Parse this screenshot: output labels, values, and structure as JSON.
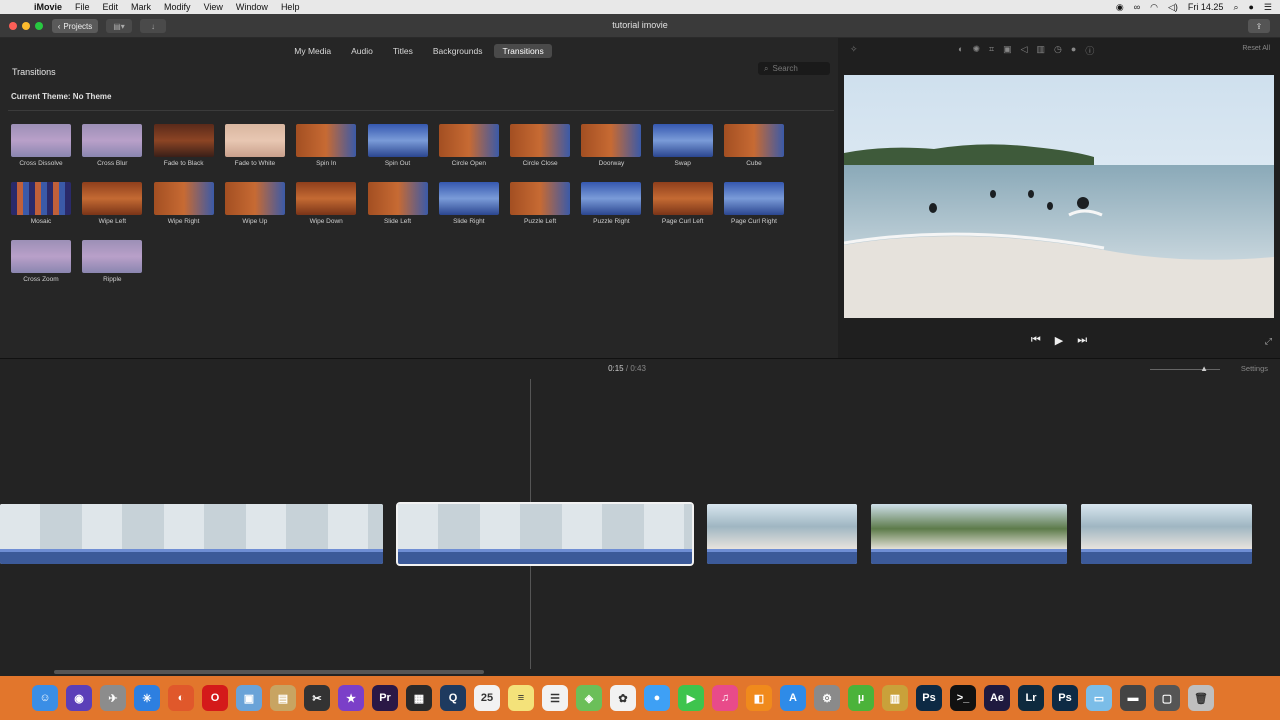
{
  "menubar": {
    "app": "iMovie",
    "items": [
      "File",
      "Edit",
      "Mark",
      "Modify",
      "View",
      "Window",
      "Help"
    ],
    "clock": "Fri 14.25"
  },
  "window": {
    "title": "tutorial imovie",
    "projects_label": "Projects"
  },
  "browser": {
    "tabs": [
      {
        "label": "My Media",
        "active": false
      },
      {
        "label": "Audio",
        "active": false
      },
      {
        "label": "Titles",
        "active": false
      },
      {
        "label": "Backgrounds",
        "active": false
      },
      {
        "label": "Transitions",
        "active": true
      }
    ],
    "section_title": "Transitions",
    "search_placeholder": "Search",
    "current_theme": "Current Theme: No Theme",
    "transitions": [
      {
        "label": "Cross Dissolve",
        "style": "purple"
      },
      {
        "label": "Cross Blur",
        "style": "purple"
      },
      {
        "label": "Fade to Black",
        "style": "dark"
      },
      {
        "label": "Fade to White",
        "style": "light"
      },
      {
        "label": "Spin In",
        "style": "mix"
      },
      {
        "label": "Spin Out",
        "style": "blue"
      },
      {
        "label": "Circle Open",
        "style": "mix"
      },
      {
        "label": "Circle Close",
        "style": "mix"
      },
      {
        "label": "Doorway",
        "style": "mix"
      },
      {
        "label": "Swap",
        "style": "blue"
      },
      {
        "label": "Cube",
        "style": "mix"
      },
      {
        "label": "Mosaic",
        "style": "mosaic"
      },
      {
        "label": "Wipe Left",
        "style": "forest"
      },
      {
        "label": "Wipe Right",
        "style": "mix"
      },
      {
        "label": "Wipe Up",
        "style": "mix"
      },
      {
        "label": "Wipe Down",
        "style": "forest"
      },
      {
        "label": "Slide Left",
        "style": "mix"
      },
      {
        "label": "Slide Right",
        "style": "blue"
      },
      {
        "label": "Puzzle Left",
        "style": "mix"
      },
      {
        "label": "Puzzle Right",
        "style": "blue"
      },
      {
        "label": "Page Curl Left",
        "style": "forest"
      },
      {
        "label": "Page Curl Right",
        "style": "blue"
      },
      {
        "label": "Cross Zoom",
        "style": "purple"
      },
      {
        "label": "Ripple",
        "style": "purple"
      }
    ]
  },
  "viewer": {
    "reset_label": "Reset All"
  },
  "timeline": {
    "current_time": "0:15",
    "separator": "/",
    "duration": "0:43",
    "settings_label": "Settings",
    "clips": [
      {
        "kind": "people"
      },
      {
        "kind": "people",
        "selected": true
      },
      {
        "kind": "beach"
      },
      {
        "kind": "palms"
      },
      {
        "kind": "beach"
      }
    ]
  },
  "dock": {
    "apps": [
      {
        "name": "finder-icon",
        "glyph": "☺",
        "color": "#3a8ee6"
      },
      {
        "name": "siri-icon",
        "glyph": "◉",
        "color": "#5b3fb8"
      },
      {
        "name": "launchpad-icon",
        "glyph": "✈",
        "color": "#8c8c8c"
      },
      {
        "name": "safari-icon",
        "glyph": "✳",
        "color": "#2d7fe0"
      },
      {
        "name": "firefox-icon",
        "glyph": "◐",
        "color": "#e0582b"
      },
      {
        "name": "opera-icon",
        "glyph": "O",
        "color": "#d41a1a"
      },
      {
        "name": "preview-icon",
        "glyph": "▣",
        "color": "#6aa3d8"
      },
      {
        "name": "notes-folder-icon",
        "glyph": "▤",
        "color": "#c8a462"
      },
      {
        "name": "final-cut-icon",
        "glyph": "✂",
        "color": "#333333"
      },
      {
        "name": "imovie-icon",
        "glyph": "★",
        "color": "#7b3fc8"
      },
      {
        "name": "premiere-icon",
        "glyph": "Pr",
        "color": "#2a1846"
      },
      {
        "name": "clapper-icon",
        "glyph": "▦",
        "color": "#2a2a2a"
      },
      {
        "name": "quicktime-icon",
        "glyph": "Q",
        "color": "#1e3a5f"
      },
      {
        "name": "calendar-icon",
        "glyph": "25",
        "color": "#f2f2f2"
      },
      {
        "name": "notes-icon",
        "glyph": "≡",
        "color": "#f4e27a"
      },
      {
        "name": "reminders-icon",
        "glyph": "☰",
        "color": "#f2f2f2"
      },
      {
        "name": "maps-icon",
        "glyph": "◈",
        "color": "#6bbf59"
      },
      {
        "name": "photos-icon",
        "glyph": "✿",
        "color": "#f2f2f2"
      },
      {
        "name": "messages-icon",
        "glyph": "●",
        "color": "#3ea0f5"
      },
      {
        "name": "facetime-icon",
        "glyph": "▶",
        "color": "#3ec44d"
      },
      {
        "name": "itunes-icon",
        "glyph": "♫",
        "color": "#e84b8a"
      },
      {
        "name": "ibooks-icon",
        "glyph": "◧",
        "color": "#f08a1c"
      },
      {
        "name": "app-store-icon",
        "glyph": "A",
        "color": "#2e8be8"
      },
      {
        "name": "system-preferences-icon",
        "glyph": "⚙",
        "color": "#8a8a8a"
      },
      {
        "name": "utorrent-icon",
        "glyph": "µ",
        "color": "#4bb33a"
      },
      {
        "name": "archive-icon",
        "glyph": "▥",
        "color": "#c9a13a"
      },
      {
        "name": "photoshop-icon",
        "glyph": "Ps",
        "color": "#0d2a44"
      },
      {
        "name": "terminal-icon",
        "glyph": ">_",
        "color": "#111111"
      },
      {
        "name": "after-effects-icon",
        "glyph": "Ae",
        "color": "#1f1a3f"
      },
      {
        "name": "lightroom-icon",
        "glyph": "Lr",
        "color": "#0e2a3e"
      },
      {
        "name": "photoshop-2-icon",
        "glyph": "Ps",
        "color": "#0d2a44"
      },
      {
        "name": "downloads-folder-icon",
        "glyph": "▭",
        "color": "#7bbde8"
      },
      {
        "name": "window-icon",
        "glyph": "▬",
        "color": "#444444"
      },
      {
        "name": "screen-icon",
        "glyph": "▢",
        "color": "#555555"
      },
      {
        "name": "trash-icon",
        "glyph": "🗑",
        "color": "#bfbfbf"
      }
    ]
  }
}
